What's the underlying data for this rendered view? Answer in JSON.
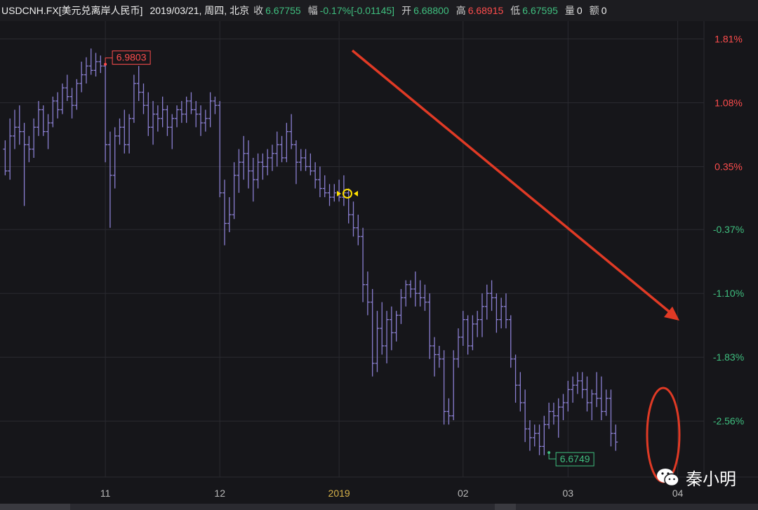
{
  "header": {
    "symbol": "USDCNH.FX[美元兑离岸人民币]",
    "datetime": "2019/03/21, 周四, 北京",
    "close_label": "收",
    "close_value": "6.67755",
    "change_label": "幅",
    "change_pct": "-0.17%",
    "change_abs": "[-0.01145]",
    "open_label": "开",
    "open_value": "6.68800",
    "high_label": "高",
    "high_value": "6.68915",
    "low_label": "低",
    "low_value": "6.67595",
    "volume_label": "量",
    "volume_value": "0",
    "amount_label": "额",
    "amount_value": "0"
  },
  "colors": {
    "bar": "#8a7fd1",
    "up_axis": "#ff4d4d",
    "down_axis": "#3fbf7f",
    "grid": "#2a2a30",
    "annotation": "#e03a25",
    "year_label": "#d8b34a"
  },
  "chart_data": {
    "type": "ohlc",
    "y_unit": "percent change",
    "ylim": [
      -3.2,
      1.95
    ],
    "x_tick_labels": [
      {
        "text": "11",
        "index": 21
      },
      {
        "text": "12",
        "index": 45
      },
      {
        "text": "2019",
        "index": 70
      },
      {
        "text": "02",
        "index": 96
      },
      {
        "text": "03",
        "index": 118
      },
      {
        "text": "04",
        "index": 141
      }
    ],
    "y_tick_labels": [
      {
        "text": "1.81%",
        "value": 1.81,
        "dir": "up"
      },
      {
        "text": "1.08%",
        "value": 1.08,
        "dir": "up"
      },
      {
        "text": "0.35%",
        "value": 0.35,
        "dir": "up"
      },
      {
        "text": "-0.37%",
        "value": -0.37,
        "dir": "down"
      },
      {
        "text": "-1.10%",
        "value": -1.1,
        "dir": "down"
      },
      {
        "text": "-1.83%",
        "value": -1.83,
        "dir": "down"
      },
      {
        "text": "-2.56%",
        "value": -2.56,
        "dir": "down"
      }
    ],
    "high_marker": {
      "label": "6.9803",
      "index": 21,
      "value": 1.52
    },
    "low_marker": {
      "label": "6.6749",
      "index": 114,
      "value": -2.92
    },
    "ohlc_pct": [
      [
        0.55,
        0.65,
        0.25,
        0.3
      ],
      [
        0.3,
        0.9,
        0.2,
        0.7
      ],
      [
        0.7,
        1.0,
        0.55,
        0.8
      ],
      [
        0.8,
        1.05,
        0.6,
        0.75
      ],
      [
        0.75,
        0.85,
        -0.1,
        0.6
      ],
      [
        0.6,
        0.7,
        0.4,
        0.55
      ],
      [
        0.55,
        0.9,
        0.45,
        0.8
      ],
      [
        0.8,
        1.1,
        0.7,
        1.0
      ],
      [
        1.0,
        1.05,
        0.7,
        0.75
      ],
      [
        0.75,
        0.95,
        0.55,
        0.85
      ],
      [
        0.85,
        1.15,
        0.8,
        1.1
      ],
      [
        1.1,
        1.2,
        0.9,
        1.0
      ],
      [
        1.0,
        1.3,
        0.95,
        1.25
      ],
      [
        1.25,
        1.4,
        1.1,
        1.15
      ],
      [
        1.15,
        1.25,
        0.9,
        1.05
      ],
      [
        1.05,
        1.35,
        1.0,
        1.3
      ],
      [
        1.3,
        1.55,
        1.2,
        1.4
      ],
      [
        1.4,
        1.6,
        1.3,
        1.5
      ],
      [
        1.5,
        1.7,
        1.4,
        1.45
      ],
      [
        1.45,
        1.65,
        1.38,
        1.55
      ],
      [
        1.55,
        1.62,
        1.42,
        1.5
      ],
      [
        1.5,
        1.52,
        0.4,
        0.6
      ],
      [
        0.6,
        0.75,
        -0.35,
        0.25
      ],
      [
        0.25,
        0.8,
        0.1,
        0.7
      ],
      [
        0.7,
        0.9,
        0.6,
        0.8
      ],
      [
        0.8,
        1.0,
        0.5,
        0.6
      ],
      [
        0.6,
        0.95,
        0.5,
        0.9
      ],
      [
        0.9,
        1.4,
        0.85,
        1.3
      ],
      [
        1.3,
        1.5,
        1.1,
        1.2
      ],
      [
        1.2,
        1.3,
        0.95,
        1.05
      ],
      [
        1.05,
        1.2,
        0.7,
        0.8
      ],
      [
        0.8,
        1.1,
        0.6,
        0.95
      ],
      [
        0.95,
        1.05,
        0.75,
        0.9
      ],
      [
        0.9,
        1.15,
        0.8,
        1.0
      ],
      [
        1.0,
        1.05,
        0.7,
        0.8
      ],
      [
        0.8,
        0.95,
        0.55,
        0.9
      ],
      [
        0.9,
        1.05,
        0.8,
        1.0
      ],
      [
        1.0,
        1.1,
        0.85,
        0.95
      ],
      [
        0.95,
        1.15,
        0.85,
        1.1
      ],
      [
        1.1,
        1.2,
        0.95,
        1.0
      ],
      [
        1.0,
        1.1,
        0.8,
        0.95
      ],
      [
        0.95,
        1.05,
        0.7,
        0.85
      ],
      [
        0.85,
        1.0,
        0.75,
        0.9
      ],
      [
        0.9,
        1.2,
        0.8,
        1.1
      ],
      [
        1.1,
        1.15,
        0.95,
        1.05
      ],
      [
        1.05,
        1.1,
        0.0,
        0.05
      ],
      [
        0.05,
        0.2,
        -0.55,
        -0.3
      ],
      [
        -0.3,
        0.0,
        -0.4,
        -0.2
      ],
      [
        -0.2,
        0.4,
        -0.25,
        0.25
      ],
      [
        0.25,
        0.55,
        0.05,
        0.4
      ],
      [
        0.4,
        0.7,
        0.2,
        0.5
      ],
      [
        0.5,
        0.65,
        0.1,
        0.3
      ],
      [
        0.3,
        0.45,
        -0.05,
        0.2
      ],
      [
        0.2,
        0.5,
        0.1,
        0.4
      ],
      [
        0.4,
        0.5,
        0.2,
        0.35
      ],
      [
        0.35,
        0.55,
        0.25,
        0.45
      ],
      [
        0.45,
        0.6,
        0.3,
        0.5
      ],
      [
        0.5,
        0.75,
        0.35,
        0.6
      ],
      [
        0.6,
        0.7,
        0.4,
        0.45
      ],
      [
        0.45,
        0.85,
        0.4,
        0.75
      ],
      [
        0.75,
        0.95,
        0.55,
        0.6
      ],
      [
        0.6,
        0.65,
        0.15,
        0.4
      ],
      [
        0.4,
        0.55,
        0.3,
        0.45
      ],
      [
        0.45,
        0.55,
        0.3,
        0.35
      ],
      [
        0.35,
        0.5,
        0.25,
        0.3
      ],
      [
        0.3,
        0.4,
        0.1,
        0.2
      ],
      [
        0.2,
        0.35,
        0.0,
        0.1
      ],
      [
        0.1,
        0.25,
        0.0,
        0.05
      ],
      [
        0.05,
        0.15,
        -0.1,
        0.0
      ],
      [
        0.0,
        0.15,
        -0.05,
        0.05
      ],
      [
        0.05,
        0.2,
        -0.05,
        0.0
      ],
      [
        0.0,
        0.25,
        -0.1,
        0.05
      ],
      [
        0.05,
        0.1,
        -0.3,
        -0.2
      ],
      [
        -0.2,
        -0.05,
        -0.45,
        -0.35
      ],
      [
        -0.35,
        -0.2,
        -0.55,
        -0.45
      ],
      [
        -0.45,
        -0.35,
        -1.2,
        -1.0
      ],
      [
        -1.0,
        -0.85,
        -1.35,
        -1.2
      ],
      [
        -1.2,
        -1.05,
        -2.05,
        -1.9
      ],
      [
        -1.9,
        -1.3,
        -2.0,
        -1.5
      ],
      [
        -1.5,
        -1.2,
        -1.8,
        -1.7
      ],
      [
        -1.7,
        -1.3,
        -1.9,
        -1.4
      ],
      [
        -1.4,
        -1.25,
        -1.75,
        -1.55
      ],
      [
        -1.55,
        -1.3,
        -1.65,
        -1.35
      ],
      [
        -1.35,
        -1.05,
        -1.45,
        -1.15
      ],
      [
        -1.15,
        -0.95,
        -1.25,
        -1.0
      ],
      [
        -1.0,
        -0.95,
        -1.15,
        -1.05
      ],
      [
        -1.05,
        -0.85,
        -1.25,
        -1.1
      ],
      [
        -1.1,
        -0.95,
        -1.25,
        -1.15
      ],
      [
        -1.15,
        -1.0,
        -1.3,
        -1.2
      ],
      [
        -1.2,
        -1.1,
        -1.85,
        -1.7
      ],
      [
        -1.7,
        -1.6,
        -2.05,
        -1.8
      ],
      [
        -1.8,
        -1.7,
        -1.95,
        -1.85
      ],
      [
        -1.85,
        -1.75,
        -2.6,
        -2.45
      ],
      [
        -2.45,
        -2.3,
        -2.6,
        -2.5
      ],
      [
        -2.5,
        -1.75,
        -2.55,
        -1.85
      ],
      [
        -1.85,
        -1.5,
        -1.95,
        -1.6
      ],
      [
        -1.6,
        -1.3,
        -1.7,
        -1.4
      ],
      [
        -1.4,
        -1.35,
        -1.8,
        -1.7
      ],
      [
        -1.7,
        -1.35,
        -1.75,
        -1.45
      ],
      [
        -1.45,
        -1.3,
        -1.6,
        -1.4
      ],
      [
        -1.4,
        -1.1,
        -1.6,
        -1.25
      ],
      [
        -1.25,
        -1.0,
        -1.4,
        -1.1
      ],
      [
        -1.1,
        -0.95,
        -1.3,
        -1.15
      ],
      [
        -1.15,
        -1.1,
        -1.55,
        -1.4
      ],
      [
        -1.4,
        -1.15,
        -1.5,
        -1.25
      ],
      [
        -1.25,
        -1.1,
        -1.5,
        -1.4
      ],
      [
        -1.4,
        -1.35,
        -1.95,
        -1.85
      ],
      [
        -1.85,
        -1.8,
        -2.35,
        -2.15
      ],
      [
        -2.15,
        -2.0,
        -2.45,
        -2.35
      ],
      [
        -2.35,
        -2.2,
        -2.8,
        -2.65
      ],
      [
        -2.65,
        -2.55,
        -2.9,
        -2.75
      ],
      [
        -2.75,
        -2.6,
        -2.85,
        -2.7
      ],
      [
        -2.7,
        -2.6,
        -2.95,
        -2.85
      ],
      [
        -2.85,
        -2.5,
        -2.95,
        -2.6
      ],
      [
        -2.6,
        -2.35,
        -2.65,
        -2.45
      ],
      [
        -2.45,
        -2.35,
        -2.6,
        -2.5
      ],
      [
        -2.5,
        -2.3,
        -2.75,
        -2.4
      ],
      [
        -2.4,
        -2.25,
        -2.55,
        -2.35
      ],
      [
        -2.35,
        -2.1,
        -2.45,
        -2.2
      ],
      [
        -2.2,
        -2.05,
        -2.35,
        -2.15
      ],
      [
        -2.15,
        -2.0,
        -2.25,
        -2.1
      ],
      [
        -2.1,
        -2.0,
        -2.3,
        -2.2
      ],
      [
        -2.2,
        -2.05,
        -2.45,
        -2.35
      ],
      [
        -2.35,
        -2.2,
        -2.55,
        -2.25
      ],
      [
        -2.25,
        -2.0,
        -2.4,
        -2.3
      ],
      [
        -2.3,
        -2.05,
        -2.55,
        -2.45
      ],
      [
        -2.45,
        -2.2,
        -2.5,
        -2.3
      ],
      [
        -2.3,
        -2.2,
        -2.85,
        -2.7
      ],
      [
        -2.7,
        -2.6,
        -2.9,
        -2.8
      ]
    ]
  },
  "watermark": {
    "icon": "wechat-icon",
    "text": "秦小明"
  }
}
